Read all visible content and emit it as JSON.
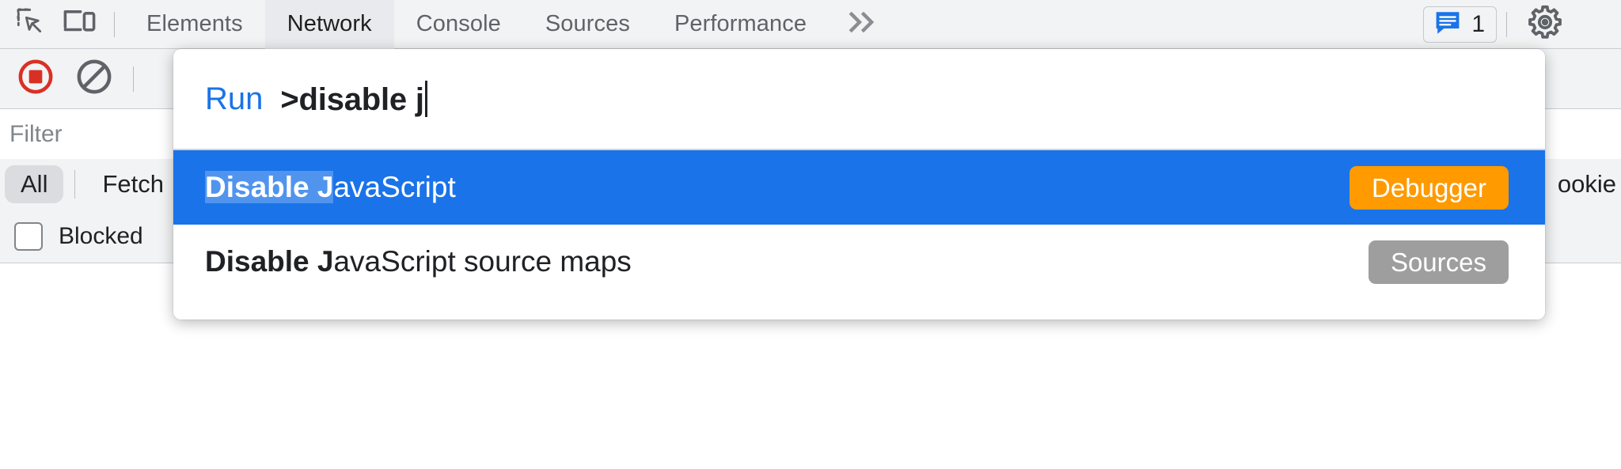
{
  "toolbar": {
    "inspect_icon": "inspect-element-icon",
    "device_icon": "device-toolbar-icon",
    "tabs": [
      {
        "label": "Elements",
        "selected": false
      },
      {
        "label": "Network",
        "selected": true
      },
      {
        "label": "Console",
        "selected": false
      },
      {
        "label": "Sources",
        "selected": false
      },
      {
        "label": "Performance",
        "selected": false
      }
    ],
    "more_tabs_icon": "chevron-double-right-icon",
    "messages_icon": "console-message-icon",
    "messages_count": "1",
    "settings_icon": "gear-icon",
    "more_options_icon": "vertical-dots-icon"
  },
  "network": {
    "record_icon": "record-stop-icon",
    "clear_icon": "clear-network-log-icon",
    "filter": {
      "placeholder": "Filter",
      "value": ""
    },
    "type_filters": [
      {
        "label": "All",
        "active": true
      },
      {
        "label": "Fetch",
        "active": false
      }
    ],
    "right_filter_label": "ookie",
    "blocked": {
      "label": "Blocked",
      "checked": false
    }
  },
  "palette": {
    "run_label": "Run",
    "query": ">disable j",
    "results": [
      {
        "highlight": "Disable J",
        "rest": "avaScript",
        "tag": "Debugger",
        "tag_color": "#ff9a00",
        "selected": true
      },
      {
        "highlight": "Disable J",
        "rest": "avaScript source maps",
        "tag": "Sources",
        "tag_color": "#9e9e9e",
        "selected": false
      }
    ]
  },
  "colors": {
    "accent_blue": "#1a73e8",
    "toolbar_bg": "#f1f3f4",
    "record_red": "#d93025"
  }
}
